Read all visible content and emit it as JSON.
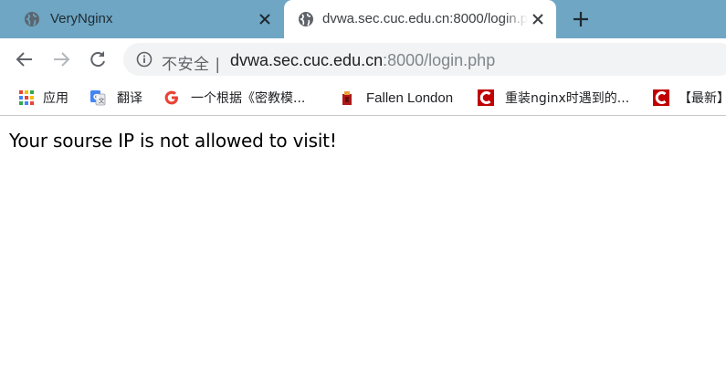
{
  "tabs": [
    {
      "title": "VeryNginx",
      "active": false,
      "favicon": "globe-icon"
    },
    {
      "title": "dvwa.sec.cuc.edu.cn:8000/login.php",
      "active": true,
      "favicon": "globe-icon"
    }
  ],
  "toolbar": {
    "back": "back-arrow-icon",
    "forward": "forward-arrow-icon",
    "reload": "reload-icon",
    "security_label": "不安全",
    "url_host": "dvwa.sec.cuc.edu.cn",
    "url_rest": ":8000/login.php"
  },
  "bookmarks": [
    {
      "label": "应用",
      "icon": "apps-grid-icon"
    },
    {
      "label": "翻译",
      "icon": "google-translate-icon"
    },
    {
      "label": "一个根据《密教模...",
      "icon": "google-g-icon"
    },
    {
      "label": "Fallen London",
      "icon": "fallen-london-icon"
    },
    {
      "label": "重装nginx时遇到的...",
      "icon": "csdn-icon"
    },
    {
      "label": "【最新】",
      "icon": "csdn-icon"
    }
  ],
  "page": {
    "message": "Your sourse IP is not allowed to visit!"
  },
  "colors": {
    "tabstrip": "#6ea6c4",
    "omnibox": "#f1f3f4",
    "csdn_red": "#c00000"
  }
}
